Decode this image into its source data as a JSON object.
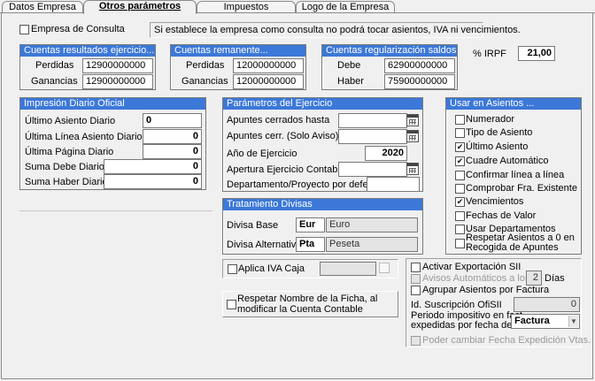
{
  "tabs": [
    {
      "label": "Datos Empresa",
      "active": false
    },
    {
      "label": "Otros parámetros",
      "active": true
    },
    {
      "label": "Impuestos",
      "active": false
    },
    {
      "label": "Logo de la Empresa",
      "active": false
    }
  ],
  "consulta": {
    "label": "Empresa de Consulta",
    "checked": false,
    "note": "Si establece la empresa como consulta no podrá tocar asientos, IVA ni vencimientos."
  },
  "resultados": {
    "title": "Cuentas resultados ejercicio...",
    "perdidas_label": "Perdidas",
    "perdidas_value": "12900000000",
    "ganancias_label": "Ganancias",
    "ganancias_value": "12900000000"
  },
  "remanente": {
    "title": "Cuentas remanente...",
    "perdidas_label": "Perdidas",
    "perdidas_value": "12000000000",
    "ganancias_label": "Ganancias",
    "ganancias_value": "12000000000"
  },
  "regularizacion": {
    "title": "Cuentas regularización saldos...",
    "debe_label": "Debe",
    "debe_value": "62900000000",
    "haber_label": "Haber",
    "haber_value": "75900000000"
  },
  "irpf": {
    "label": "% IRPF",
    "value": "21,00"
  },
  "impresion": {
    "title": "Impresión Diario Oficial",
    "ultimo_asiento_label": "Último Asiento Diario",
    "ultimo_asiento_value": "0",
    "ultima_linea_label": "Última Línea  Asiento Diario",
    "ultima_linea_value": "0",
    "ultima_pagina_label": "Última Página Diario",
    "ultima_pagina_value": "0",
    "suma_debe_label": "Suma Debe Diario",
    "suma_debe_value": "0",
    "suma_haber_label": "Suma Haber Diario",
    "suma_haber_value": "0"
  },
  "ejercicio": {
    "title": "Parámetros del Ejercicio",
    "apuntes_cerrados_label": "Apuntes cerrados hasta",
    "apuntes_cerrados_value": "",
    "apuntes_cerr_label": "Apuntes cerr. (Solo Aviso)",
    "apuntes_cerr_value": "",
    "anio_label": "Año de Ejercicio",
    "anio_value": "2020",
    "apertura_label": "Apertura Ejercicio Contable",
    "apertura_value": "",
    "departamento_label": "Departamento/Proyecto por defecto",
    "departamento_value": ""
  },
  "asientos": {
    "title": "Usar en Asientos ...",
    "items": [
      {
        "label": "Numerador",
        "checked": false
      },
      {
        "label": "Tipo de Asiento",
        "checked": false
      },
      {
        "label": "Último Asiento",
        "checked": true
      },
      {
        "label": "Cuadre Automático",
        "checked": true
      },
      {
        "label": "Confirmar línea a línea",
        "checked": false
      },
      {
        "label": "Comprobar Fra. Existente",
        "checked": false
      },
      {
        "label": "Vencimientos",
        "checked": true
      },
      {
        "label": "Fechas de Valor",
        "checked": false
      },
      {
        "label": "Usar Departamentos",
        "checked": false
      }
    ],
    "respetar_line1": "Respetar Asientos a 0 en",
    "respetar_line2": "Recogida de Apuntes",
    "respetar_checked": false
  },
  "divisas": {
    "title": "Tratamiento Divisas",
    "base_label": "Divisa Base",
    "base_code": "Eur",
    "base_name": "Euro",
    "alt_label": "Divisa Alternativa",
    "alt_code": "Pta",
    "alt_name": "Peseta"
  },
  "iva_caja": {
    "label": "Aplica IVA Caja",
    "checked": false
  },
  "respetar_ficha": {
    "line1": "Respetar Nombre de la Ficha, al",
    "line2": "modificar la Cuenta Contable",
    "checked": false
  },
  "sii": {
    "activar_label": "Activar Exportación SII",
    "activar_checked": false,
    "avisos_label": "Avisos Automáticos a los",
    "avisos_value": "2",
    "dias_label": "Días",
    "agrupar_label": "Agrupar Asientos por Factura",
    "agrupar_checked": false,
    "suscripcion_label": "Id. Suscripción OfiSII",
    "suscripcion_value": "0",
    "periodo_line1": "Periodo impositivo en fact.",
    "periodo_line2": "expedidas por fecha de",
    "periodo_value": "Factura",
    "poder_label": "Poder cambiar Fecha Expedición Vtas."
  }
}
